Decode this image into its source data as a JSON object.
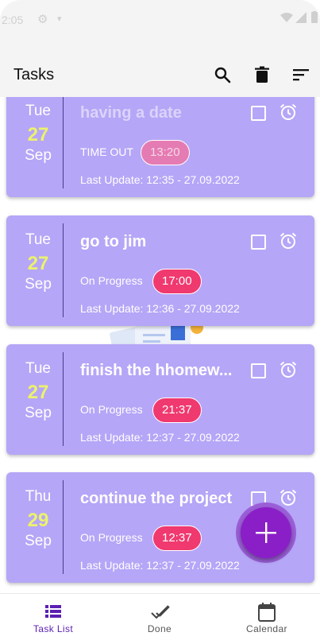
{
  "status_bar": {
    "time": "2:05"
  },
  "app_bar": {
    "title": "Tasks",
    "icons": [
      "search-icon",
      "delete-icon",
      "sort-icon"
    ]
  },
  "tasks": [
    {
      "dow": "Tue",
      "day": "27",
      "month": "Sep",
      "title": "having a date",
      "status": "TIME OUT",
      "time": "13:20",
      "last_update": "Last Update: 12:35 - 27.09.2022"
    },
    {
      "dow": "Tue",
      "day": "27",
      "month": "Sep",
      "title": "go to jim",
      "status": "On Progress",
      "time": "17:00",
      "last_update": "Last Update: 12:36 - 27.09.2022"
    },
    {
      "dow": "Tue",
      "day": "27",
      "month": "Sep",
      "title": "finish the hhomew...",
      "status": "On Progress",
      "time": "21:37",
      "last_update": "Last Update: 12:37 - 27.09.2022"
    },
    {
      "dow": "Thu",
      "day": "29",
      "month": "Sep",
      "title": "continue the project",
      "status": "On Progress",
      "time": "12:37",
      "last_update": "Last Update: 12:37 - 27.09.2022"
    }
  ],
  "bottom_nav": [
    {
      "label": "Task List",
      "icon": "list-icon",
      "active": true
    },
    {
      "label": "Done",
      "icon": "check-icon",
      "active": false
    },
    {
      "label": "Calendar",
      "icon": "calendar-icon",
      "active": false
    }
  ],
  "colors": {
    "card": "#b5a6f7",
    "accent_day": "#ecf26b",
    "time_pill": "#f0396f",
    "fab": "#8a1fc7",
    "nav_active": "#5b1fb2"
  }
}
